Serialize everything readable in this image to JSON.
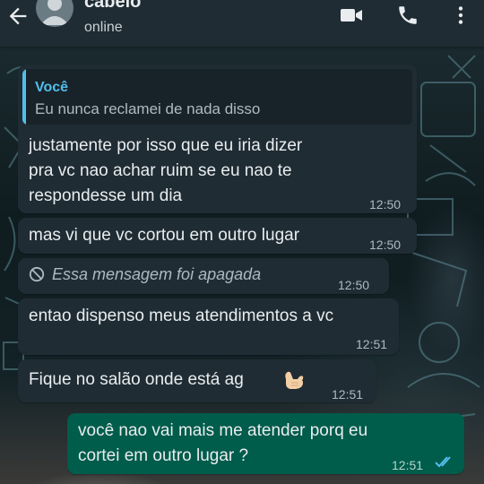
{
  "header": {
    "contact_name": "cabelo",
    "status": "online",
    "icons": [
      "back-arrow-icon",
      "avatar",
      "video-call-icon",
      "phone-icon",
      "more-vert-icon"
    ]
  },
  "colors": {
    "header_bg": "#1f2c34",
    "incoming_bubble": "#1f2c34",
    "outgoing_bubble": "#005c4b",
    "quote_accent": "#53bdeb",
    "read_ticks": "#53bdeb"
  },
  "messages": [
    {
      "direction": "in",
      "quote_author": "Você",
      "quote_text": "Eu nunca reclamei de nada disso",
      "lines": [
        "justamente por isso que eu iria dizer",
        "pra vc nao achar ruim se eu nao te",
        "respondesse um dia"
      ],
      "time": "12:50"
    },
    {
      "direction": "in",
      "text": "mas vi que vc cortou em outro lugar",
      "time": "12:50"
    },
    {
      "direction": "in",
      "deleted": true,
      "text": "Essa mensagem foi apagada",
      "time": "12:50"
    },
    {
      "direction": "in",
      "text": "entao dispenso meus atendimentos a vc",
      "time": "12:51"
    },
    {
      "direction": "in",
      "text": "Fique no salão onde está ag",
      "emoji": "call-me-hand-emoji",
      "time": "12:51"
    },
    {
      "direction": "out",
      "lines": [
        "você nao vai mais me atender porq eu",
        "cortei em outro lugar ?"
      ],
      "time": "12:51",
      "status": "read"
    }
  ]
}
